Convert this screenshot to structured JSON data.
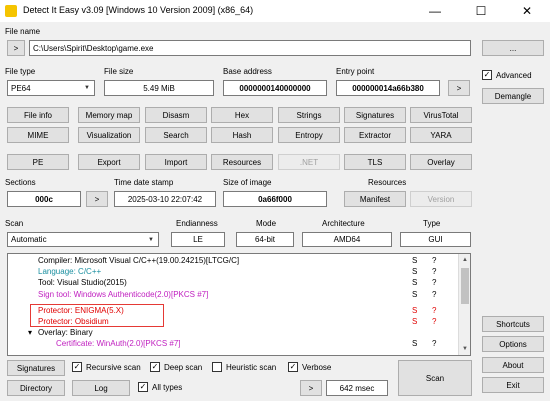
{
  "window": {
    "title": "Detect It Easy v3.09 [Windows 10 Version 2009] (x86_64)",
    "minimize": "—",
    "maximize": "☐",
    "close": "✕"
  },
  "file": {
    "label": "File name",
    "browse_arrow": ">",
    "path": "C:\\Users\\Spirit\\Desktop\\game.exe",
    "more_button": "..."
  },
  "info": {
    "file_type_label": "File type",
    "file_type": "PE64",
    "file_size_label": "File size",
    "file_size": "5.49 MiB",
    "base_address_label": "Base address",
    "base_address": "0000000140000000",
    "entry_point_label": "Entry point",
    "entry_point": "000000014a66b380",
    "entry_arrow": ">",
    "advanced_label": "Advanced",
    "demangle": "Demangle"
  },
  "tools_row1": [
    "File info",
    "Memory map",
    "Disasm",
    "Hex",
    "Strings",
    "Signatures",
    "VirusTotal"
  ],
  "tools_row2": [
    "MIME",
    "Visualization",
    "Search",
    "Hash",
    "Entropy",
    "Extractor",
    "YARA"
  ],
  "tools_row3": [
    "PE",
    "Export",
    "Import",
    "Resources",
    ".NET",
    "TLS",
    "Overlay"
  ],
  "sections": {
    "sections_label": "Sections",
    "sections_value": "000c",
    "sections_arrow": ">",
    "timestamp_label": "Time date stamp",
    "timestamp": "2025-03-10 22:07:42",
    "size_label": "Size of image",
    "size_value": "0a66f000",
    "resources_label": "Resources",
    "manifest": "Manifest",
    "version": "Version"
  },
  "scan_params": {
    "scan_label": "Scan",
    "scan_value": "Automatic",
    "endianness_label": "Endianness",
    "endianness": "LE",
    "mode_label": "Mode",
    "mode": "64-bit",
    "arch_label": "Architecture",
    "arch": "AMD64",
    "type_label": "Type",
    "type": "GUI"
  },
  "results": [
    {
      "text": "Compiler: Microsoft Visual C/C++(19.00.24215)[LTCG/C]",
      "color": "#000000",
      "indent": 1,
      "s": "S",
      "q": "?"
    },
    {
      "text": "Language: C/C++",
      "color": "#1a8fa0",
      "indent": 1,
      "s": "S",
      "q": "?"
    },
    {
      "text": "Tool: Visual Studio(2015)",
      "color": "#000000",
      "indent": 1,
      "s": "S",
      "q": "?"
    },
    {
      "text": "Sign tool: Windows Authenticode(2.0)[PKCS #7]",
      "color": "#c020c0",
      "indent": 1,
      "s": "S",
      "q": "?"
    },
    {
      "text": "Protector: ENIGMA(5.X)",
      "color": "#e00000",
      "indent": 1,
      "s": "S",
      "q": "?"
    },
    {
      "text": "Protector: Obsidium",
      "color": "#e00000",
      "indent": 1,
      "s": "S",
      "q": "?"
    },
    {
      "text": "Overlay: Binary",
      "color": "#000000",
      "indent": 0,
      "s": "",
      "q": ""
    },
    {
      "text": "Certificate: WinAuth(2.0)[PKCS #7]",
      "color": "#c020c0",
      "indent": 2,
      "s": "S",
      "q": "?"
    }
  ],
  "side": {
    "shortcuts": "Shortcuts",
    "options": "Options",
    "about": "About",
    "exit": "Exit"
  },
  "bottom": {
    "signatures": "Signatures",
    "recursive": "Recursive scan",
    "deep": "Deep scan",
    "heuristic": "Heuristic scan",
    "verbose": "Verbose",
    "directory": "Directory",
    "log": "Log",
    "all_types": "All types",
    "time_arrow": ">",
    "time": "642 msec",
    "scan": "Scan",
    "check": "✓"
  }
}
